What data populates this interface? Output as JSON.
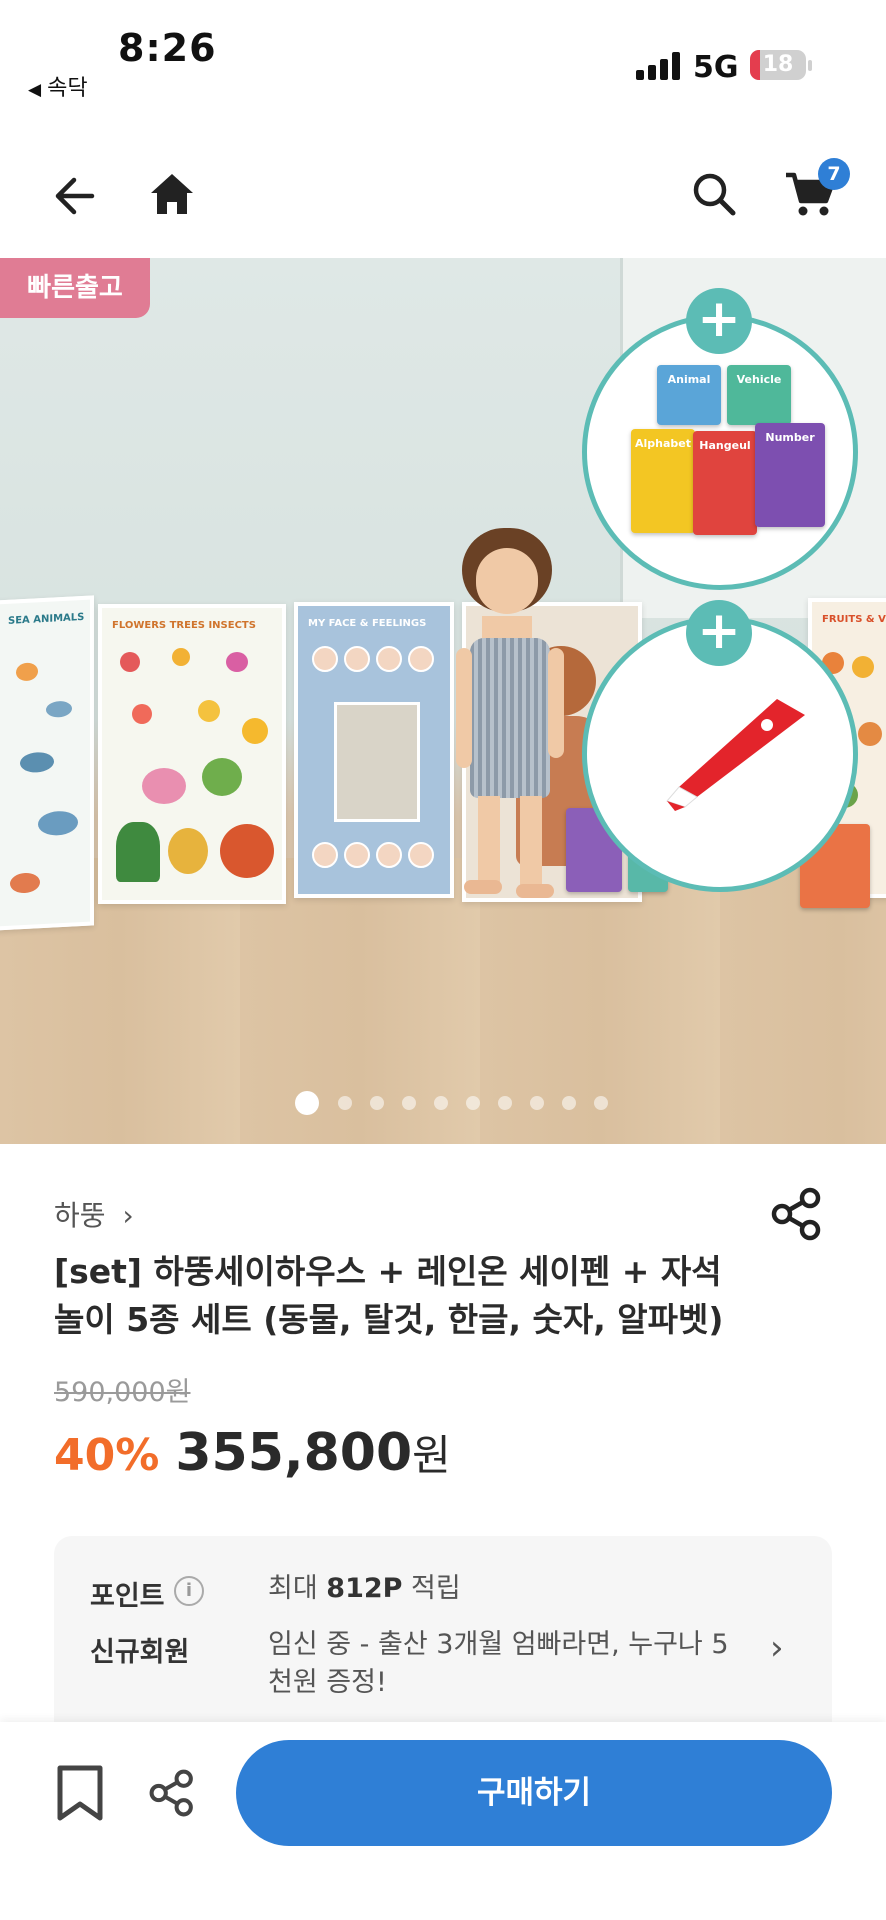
{
  "status_bar": {
    "time": "8:26",
    "back_app": "속닥",
    "network": "5G",
    "battery": "18",
    "battery_level": 0.18
  },
  "nav": {
    "cart_count": "7",
    "icons": [
      "back-arrow-icon",
      "home-icon",
      "search-icon",
      "cart-icon"
    ]
  },
  "hero": {
    "badge": "빠른출고",
    "panel_titles": [
      "SEA ANIMALS",
      "FLOWERS TREES INSECTS",
      "MY FACE & FEELINGS",
      "FRUITS & VEGE"
    ],
    "card_labels": [
      "Animal",
      "Vehicle",
      "Alphabet",
      "Hangeul",
      "Number"
    ],
    "carousel_total": 10,
    "carousel_active": 1,
    "colors": {
      "bubble_border": "#5cbcb5",
      "badge": "#e07c94"
    }
  },
  "product": {
    "brand": "하뚱",
    "title_line1": "[set] 하뚱세이하우스 + 레인온 세이펜 + 자석",
    "title_line2": "놀이 5종 세트 (동물, 탈것, 한글, 숫자, 알파벳)",
    "original_price": "590,000원",
    "discount": "40%",
    "sale_price": "355,800",
    "currency": "원",
    "colors": {
      "discount": "#f26d2a",
      "accent": "#2f7fd6"
    }
  },
  "benefits": {
    "point_label": "포인트",
    "point_prefix": "최대",
    "point_amount": "812P",
    "point_suffix": "적립",
    "member_label": "신규회원",
    "member_line1": "임신 중 - 출산 3개월 엄빠라면, 누구나 5",
    "member_line2": "천원 증정!"
  },
  "bottom_bar": {
    "buy_label": "구매하기"
  }
}
